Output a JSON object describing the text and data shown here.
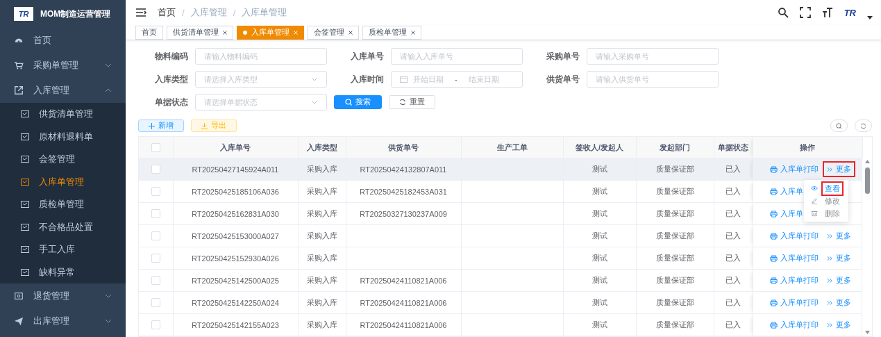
{
  "sidebar": {
    "logo_text": "TR",
    "title": "MOM制造运营管理",
    "items": [
      {
        "label": "首页"
      },
      {
        "label": "采购单管理",
        "expanded": false
      },
      {
        "label": "入库管理",
        "expanded": true,
        "children": [
          {
            "label": "供货清单管理",
            "selected": false
          },
          {
            "label": "原材料退料单",
            "selected": false
          },
          {
            "label": "会签管理",
            "selected": false
          },
          {
            "label": "入库单管理",
            "selected": true
          },
          {
            "label": "质检单管理",
            "selected": false
          },
          {
            "label": "不合格品处置",
            "selected": false
          },
          {
            "label": "手工入库",
            "selected": false
          },
          {
            "label": "缺料异常",
            "selected": false
          }
        ]
      },
      {
        "label": "退货管理",
        "expanded": false
      },
      {
        "label": "出库管理",
        "expanded": false
      }
    ]
  },
  "breadcrumb": [
    {
      "label": "首页"
    },
    {
      "separator": "/",
      "label": "入库管理"
    },
    {
      "separator": "/",
      "label": "入库单管理"
    }
  ],
  "header": {
    "logo_text": "TR"
  },
  "tags": [
    {
      "label": "首页",
      "selected": false,
      "closable": false
    },
    {
      "label": "供货清单管理",
      "selected": false,
      "closable": true
    },
    {
      "label": "入库单管理",
      "selected": true,
      "closable": true
    },
    {
      "label": "会签管理",
      "selected": false,
      "closable": true
    },
    {
      "label": "质检单管理",
      "selected": false,
      "closable": true
    }
  ],
  "filters": [
    {
      "label": "物料编码",
      "kind": "input",
      "placeholder": "请输入物料编码"
    },
    {
      "label": "入库单号",
      "kind": "input",
      "placeholder": "请输入入库单号"
    },
    {
      "label": "采购单号",
      "kind": "input",
      "placeholder": "请输入采购单号"
    },
    {
      "label": "入库类型",
      "kind": "select",
      "placeholder": "请选择入库类型"
    },
    {
      "label": "入库时间",
      "kind": "daterange",
      "placeholder": "开始日期",
      "separator": "-",
      "placeholder_end": "结束日期"
    },
    {
      "label": "供货单号",
      "kind": "input",
      "placeholder": "请输入供货单号"
    },
    {
      "label": "单据状态",
      "kind": "select",
      "placeholder": "请选择单据状态"
    }
  ],
  "search_button": "搜索",
  "reset_button": "重置",
  "toolbar": [
    {
      "label": "新增",
      "kind": "add"
    },
    {
      "label": "导出",
      "kind": "export"
    }
  ],
  "table": {
    "select_all_checked": false,
    "columns": [
      "入库单号",
      "入库类型",
      "供货单号",
      "生产工单",
      "签收人/发起人",
      "发起部门",
      "单据状态",
      "操作"
    ],
    "rows": [
      {
        "checked": false,
        "hovered": true,
        "cells": [
          "RT20250427145924A011",
          "采购入库",
          "RT20250424132807A011",
          "",
          "测试",
          "质量保证部",
          "已入"
        ],
        "print": "入库单打印",
        "more": "更多",
        "more_highlighted": true
      },
      {
        "checked": false,
        "hovered": false,
        "cells": [
          "RT20250425185106A036",
          "采购入库",
          "RT20250425182453A031",
          "",
          "测试",
          "质量保证部",
          "已入"
        ],
        "print": "入库单"
      },
      {
        "checked": false,
        "hovered": false,
        "cells": [
          "RT20250425162831A030",
          "采购入库",
          "RT20250327130237A009",
          "",
          "测试",
          "质量保证部",
          "已入"
        ],
        "print": "入库单"
      },
      {
        "checked": false,
        "hovered": false,
        "cells": [
          "RT20250425153000A027",
          "采购入库",
          "",
          "",
          "测试",
          "质量保证部",
          "已入"
        ],
        "print": "入库单打印",
        "more": "更多",
        "more_highlighted": false
      },
      {
        "checked": false,
        "hovered": false,
        "cells": [
          "RT20250425152930A026",
          "采购入库",
          "",
          "",
          "测试",
          "质量保证部",
          "已入"
        ],
        "print": "入库单打印",
        "more": "更多",
        "more_highlighted": false
      },
      {
        "checked": false,
        "hovered": false,
        "cells": [
          "RT20250425142500A025",
          "采购入库",
          "RT20250424110821A006",
          "",
          "测试",
          "质量保证部",
          "已入"
        ],
        "print": "入库单打印",
        "more": "更多",
        "more_highlighted": false
      },
      {
        "checked": false,
        "hovered": false,
        "cells": [
          "RT20250425142250A024",
          "采购入库",
          "RT20250424110821A006",
          "",
          "测试",
          "质量保证部",
          "已入"
        ],
        "print": "入库单打印",
        "more": "更多",
        "more_highlighted": false
      },
      {
        "checked": false,
        "hovered": false,
        "cells": [
          "RT20250425142155A023",
          "采购入库",
          "RT20250424110821A006",
          "",
          "测试",
          "质量保证部",
          "已入"
        ],
        "print": "入库单打印",
        "more": "更多",
        "more_highlighted": false
      }
    ]
  },
  "more_menu": [
    {
      "label": "查看",
      "disabled": false,
      "highlighted": true
    },
    {
      "label": "修改",
      "disabled": true,
      "highlighted": false
    },
    {
      "label": "删除",
      "disabled": true,
      "highlighted": false
    }
  ]
}
